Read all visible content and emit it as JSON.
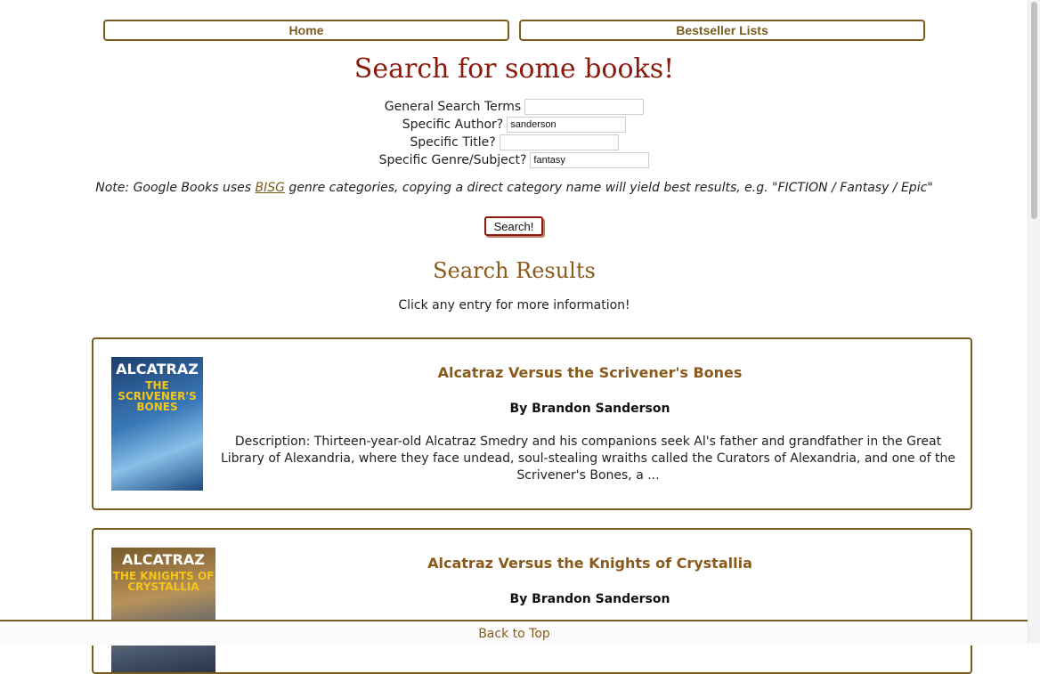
{
  "nav": {
    "home_label": "Home",
    "bestseller_label": "Bestseller Lists"
  },
  "search": {
    "title": "Search for some books!",
    "fields": [
      {
        "label": "General Search Terms",
        "value": ""
      },
      {
        "label": "Specific Author?",
        "value": "sanderson"
      },
      {
        "label": "Specific Title?",
        "value": ""
      },
      {
        "label": "Specific Genre/Subject?",
        "value": "fantasy"
      }
    ],
    "note_prefix": "Note: Google Books uses ",
    "note_link": "BISG",
    "note_suffix": " genre categories, copying a direct category name will yield best results, e.g. \"FICTION / Fantasy / Epic\"",
    "button_label": "Search!"
  },
  "results": {
    "title": "Search Results",
    "hint": "Click any entry for more information!",
    "items": [
      {
        "title": "Alcatraz Versus the Scrivener's Bones",
        "author": "By Brandon Sanderson",
        "description": "Description: Thirteen-year-old Alcatraz Smedry and his companions seek Al's father and grandfather in the Great Library of Alexandria, where they face undead, soul-stealing wraiths called the Curators of Alexandria, and one of the Scrivener's Bones, a ...",
        "cover_title": "ALCATRAZ",
        "cover_subtitle": "THE SCRIVENER'S BONES"
      },
      {
        "title": "Alcatraz Versus the Knights of Crystallia",
        "author": "By Brandon Sanderson",
        "description": "",
        "cover_title": "ALCATRAZ",
        "cover_subtitle": "THE KNIGHTS OF CRYSTALLIA"
      }
    ]
  },
  "footer": {
    "back_to_top": "Back to Top"
  }
}
